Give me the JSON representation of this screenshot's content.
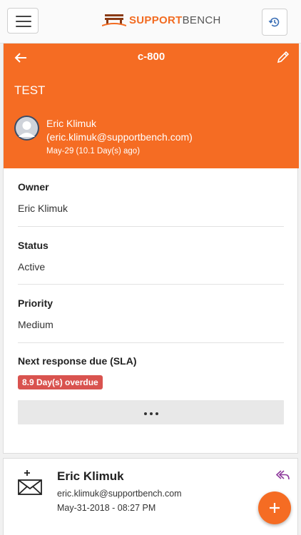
{
  "header": {
    "brand_accent": "SUPPORT",
    "brand_rest": "BENCH",
    "menu_icon": "hamburger-icon",
    "history_icon": "history-icon",
    "accent_color": "#f56c23"
  },
  "case": {
    "id": "c-800",
    "subject": "TEST",
    "requester": {
      "name": "Eric Klimuk",
      "email": "(eric.klimuk@supportbench.com)",
      "date": "May-29  (10.1 Day(s) ago)"
    }
  },
  "fields": {
    "owner": {
      "label": "Owner",
      "value": "Eric Klimuk"
    },
    "status": {
      "label": "Status",
      "value": "Active"
    },
    "priority": {
      "label": "Priority",
      "value": "Medium"
    },
    "sla": {
      "label": "Next response due (SLA)",
      "value": "8.9 Day(s) overdue",
      "badge_color": "#d9534f"
    }
  },
  "message": {
    "name": "Eric Klimuk",
    "email": "eric.klimuk@supportbench.com",
    "date": "May-31-2018 - 08:27 PM",
    "icon": "new-mail-icon",
    "reply_icon": "reply-all-icon"
  },
  "fab_icon": "plus-icon"
}
